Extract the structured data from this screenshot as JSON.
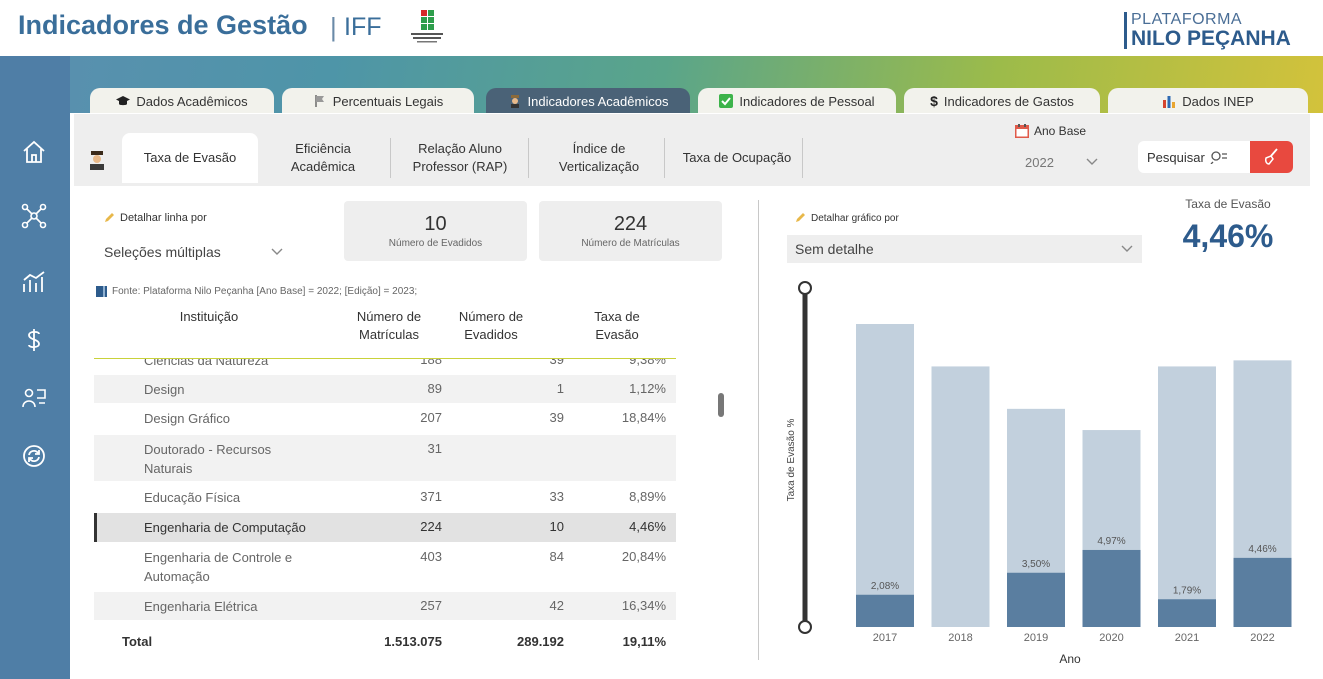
{
  "header": {
    "title": "Indicadores de Gestão",
    "separator": "|",
    "subtitle": "IFF",
    "brand_line1": "PLATAFORMA",
    "brand_line2": "NILO PEÇANHA"
  },
  "top_tabs": [
    {
      "label": "Dados Acadêmicos",
      "icon": "graduation-cap-icon",
      "active": false
    },
    {
      "label": "Percentuais Legais",
      "icon": "flag-icon",
      "active": false
    },
    {
      "label": "Indicadores Acadêmicos",
      "icon": "student-icon",
      "active": true
    },
    {
      "label": "Indicadores de Pessoal",
      "icon": "checkbox-icon",
      "active": false
    },
    {
      "label": "Indicadores de Gastos",
      "icon": "dollar-icon",
      "active": false
    },
    {
      "label": "Dados INEP",
      "icon": "bar-chart-icon",
      "active": false
    }
  ],
  "sub_tabs": [
    {
      "label": "Taxa de Evasão",
      "active": true
    },
    {
      "label": "Eficiência Acadêmica",
      "active": false
    },
    {
      "label": "Relação Aluno Professor (RAP)",
      "active": false
    },
    {
      "label": "Índice de Verticalização",
      "active": false
    },
    {
      "label": "Taxa de Ocupação",
      "active": false
    }
  ],
  "ano_base": {
    "label": "Ano Base",
    "value": "2022"
  },
  "search": {
    "label": "Pesquisar"
  },
  "left_filter": {
    "label": "Detalhar linha por",
    "value": "Seleções múltiplas"
  },
  "kpis": [
    {
      "value": "10",
      "label": "Número de Evadidos"
    },
    {
      "value": "224",
      "label": "Número de Matrículas"
    }
  ],
  "source_note": "Fonte: Plataforma Nilo Peçanha [Ano Base] = 2022; [Edição] = 2023;",
  "table": {
    "headers": [
      "Instituição",
      "Número de Matrículas",
      "Número de Evadidos",
      "Taxa de Evasão"
    ],
    "partial_row": {
      "name": "Ciências da Natureza",
      "matriculas": "188",
      "evadidos": "39",
      "taxa": "9,38%"
    },
    "rows": [
      {
        "name": "Design",
        "matriculas": "89",
        "evadidos": "1",
        "taxa": "1,12%",
        "selected": false
      },
      {
        "name": "Design Gráfico",
        "matriculas": "207",
        "evadidos": "39",
        "taxa": "18,84%",
        "selected": false
      },
      {
        "name": "Doutorado - Recursos Naturais",
        "matriculas": "31",
        "evadidos": "",
        "taxa": "",
        "selected": false
      },
      {
        "name": "Educação Física",
        "matriculas": "371",
        "evadidos": "33",
        "taxa": "8,89%",
        "selected": false
      },
      {
        "name": "Engenharia de Computação",
        "matriculas": "224",
        "evadidos": "10",
        "taxa": "4,46%",
        "selected": true
      },
      {
        "name": "Engenharia de Controle e Automação",
        "matriculas": "403",
        "evadidos": "84",
        "taxa": "20,84%",
        "selected": false
      },
      {
        "name": "Engenharia Elétrica",
        "matriculas": "257",
        "evadidos": "42",
        "taxa": "16,34%",
        "selected": false
      }
    ],
    "total": {
      "label": "Total",
      "matriculas": "1.513.075",
      "evadidos": "289.192",
      "taxa": "19,11%"
    }
  },
  "right_filter": {
    "label": "Detalhar gráfico por",
    "value": "Sem detalhe"
  },
  "big_kpi": {
    "label": "Taxa de Evasão",
    "value": "4,46%"
  },
  "chart_data": {
    "type": "bar",
    "categories": [
      "2017",
      "2018",
      "2019",
      "2020",
      "2021",
      "2022"
    ],
    "values": [
      2.08,
      null,
      3.5,
      4.97,
      1.79,
      4.46
    ],
    "value_labels": [
      "2,08%",
      "",
      "3,50%",
      "4,97%",
      "1,79%",
      "4,46%"
    ],
    "background_values": [
      10.0,
      8.6,
      7.2,
      6.5,
      8.6,
      8.8
    ],
    "xlabel": "Ano",
    "ylabel": "Taxa de Evasão %",
    "ylim": [
      0,
      10
    ],
    "colors": {
      "foreground": "#5a7ea0",
      "background": "#c2d0dd"
    }
  }
}
